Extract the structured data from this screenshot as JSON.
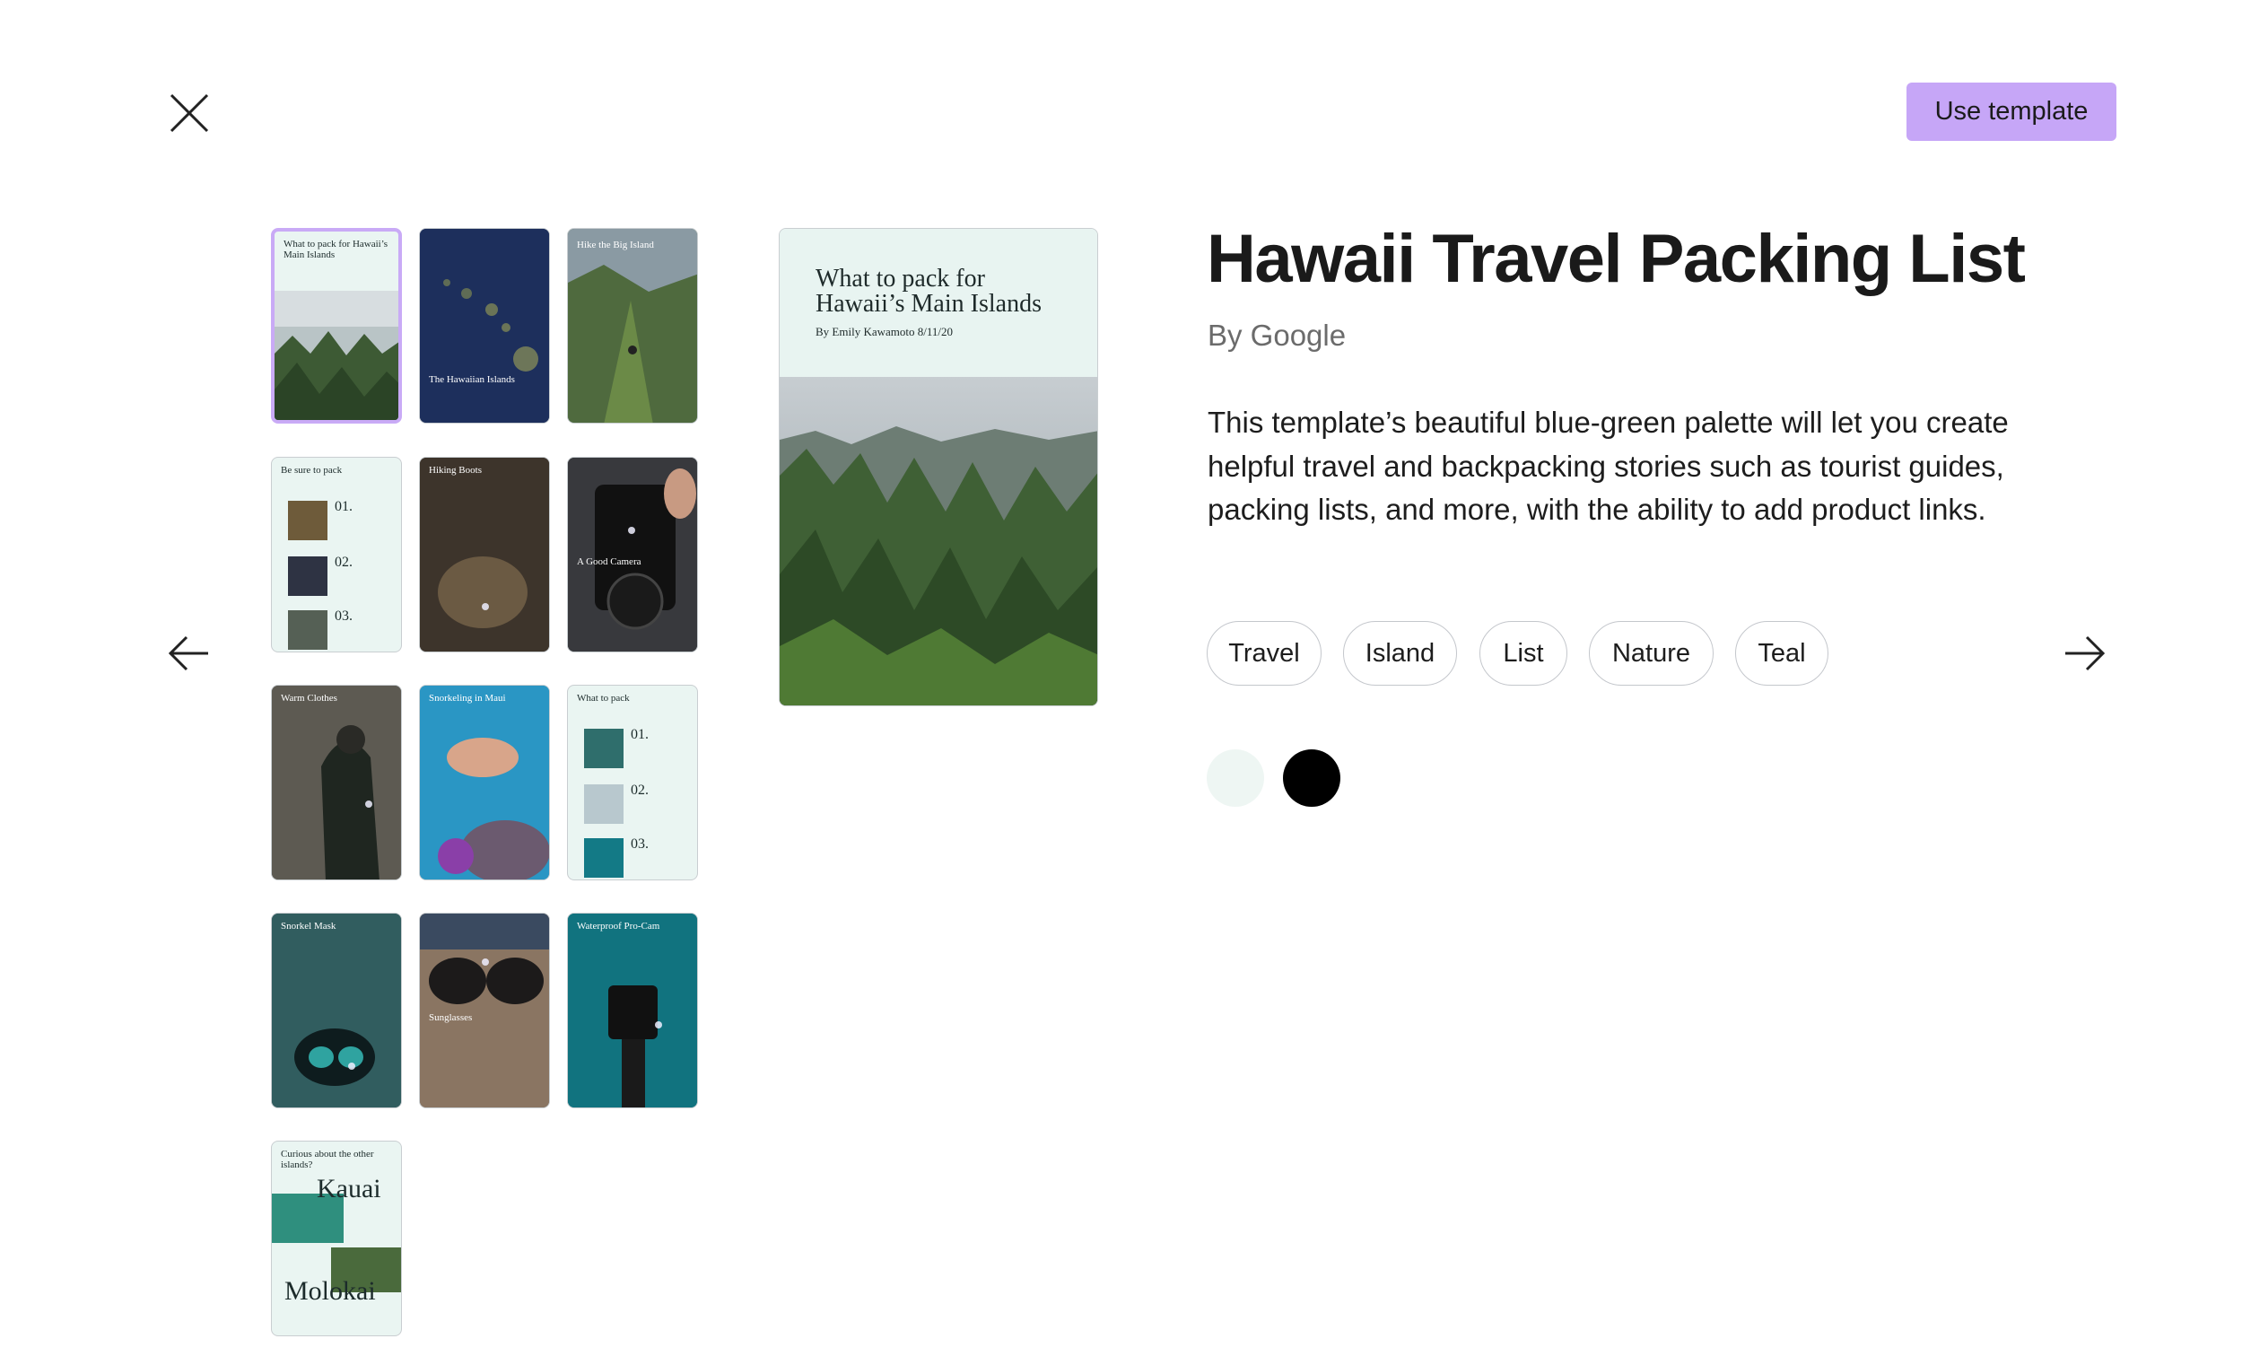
{
  "header": {
    "close_label": "close",
    "use_template": "Use template"
  },
  "template": {
    "title": "Hawaii Travel Packing List",
    "author": "By Google",
    "description": "This template’s beautiful blue-green palette will let you create helpful travel and backpacking stories such as tourist guides, packing lists, and more, with the ability to add product links.",
    "tags": [
      "Travel",
      "Island",
      "List",
      "Nature",
      "Teal"
    ],
    "colors": [
      "#eef6f3",
      "#000000"
    ]
  },
  "preview": {
    "title": "What to pack for Hawaii’s Main Islands",
    "byline": "By Emily Kawamoto 8/11/20"
  },
  "pages": {
    "p1": "What to pack for Hawaii’s Main Islands",
    "p2": "The Hawaiian Islands",
    "p3": "Hike the Big Island",
    "p4": "Be sure to pack",
    "p5": "Hiking Boots",
    "p6": "A Good Camera",
    "p7": "Warm Clothes",
    "p8": "Snorkeling in Maui",
    "p9": "What to pack",
    "p10": "Snorkel Mask",
    "p11": "Sunglasses",
    "p12": "Waterproof Pro-Cam",
    "p13": "Curious about the other islands?",
    "p13_a": "Kauai",
    "p13_b": "Molokai",
    "num1": "01.",
    "num2": "02.",
    "num3": "03."
  }
}
